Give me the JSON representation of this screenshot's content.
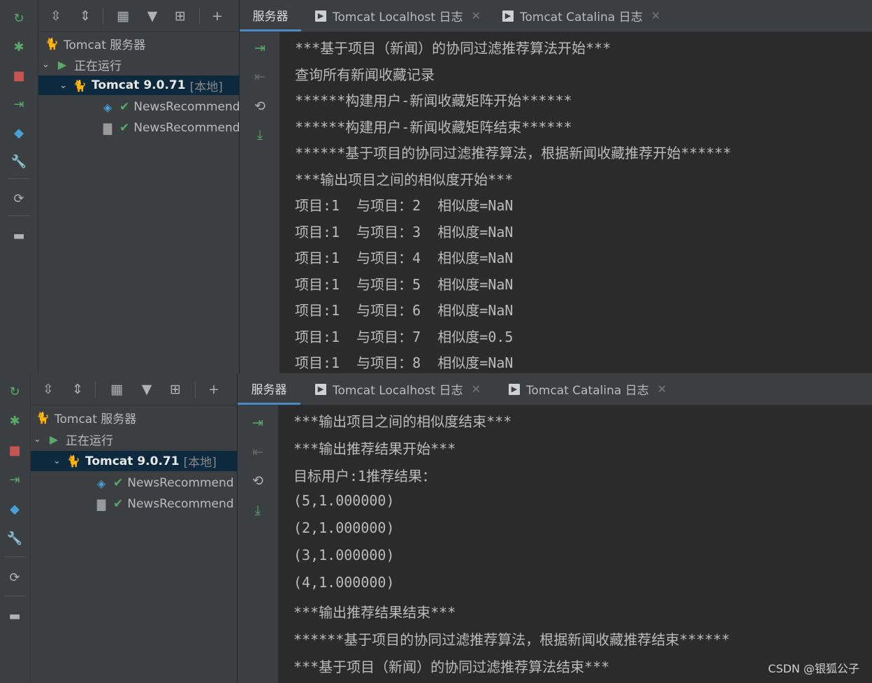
{
  "tabs": {
    "servers": "服务器",
    "localhost": "Tomcat Localhost 日志",
    "catalina": "Tomcat Catalina 日志"
  },
  "tree": {
    "root": "Tomcat 服务器",
    "running": "正在运行",
    "server_name": "Tomcat 9.0.71",
    "server_tag": "[本地]",
    "artifact1": "NewsRecommend",
    "artifact2": "NewsRecommend"
  },
  "console_top": [
    "***基于项目（新闻）的协同过滤推荐算法开始***",
    "查询所有新闻收藏记录",
    "******构建用户-新闻收藏矩阵开始******",
    "******构建用户-新闻收藏矩阵结束******",
    "******基于项目的协同过滤推荐算法，根据新闻收藏推荐开始******",
    "***输出项目之间的相似度开始***",
    "项目:1  与项目：2  相似度=NaN",
    "项目:1  与项目：3  相似度=NaN",
    "项目:1  与项目：4  相似度=NaN",
    "项目:1  与项目：5  相似度=NaN",
    "项目:1  与项目：6  相似度=NaN",
    "项目:1  与项目：7  相似度=0.5",
    "项目:1  与项目：8  相似度=NaN"
  ],
  "console_bottom": [
    "***输出项目之间的相似度结束***",
    "***输出推荐结果开始***",
    "目标用户:1推荐结果：",
    "(5,1.000000)",
    "(2,1.000000)",
    "(3,1.000000)",
    "(4,1.000000)",
    "***输出推荐结果结束***",
    "******基于项目的协同过滤推荐算法，根据新闻收藏推荐结束******",
    "***基于项目（新闻）的协同过滤推荐算法结束***"
  ],
  "watermark": "CSDN @银狐公子",
  "colors": {
    "background": "#2b2b2b",
    "panel": "#3c3f41",
    "selection": "#0d293e",
    "accent_tab": "#4a88c7",
    "run_green": "#59a869",
    "stop_red": "#c75450"
  }
}
